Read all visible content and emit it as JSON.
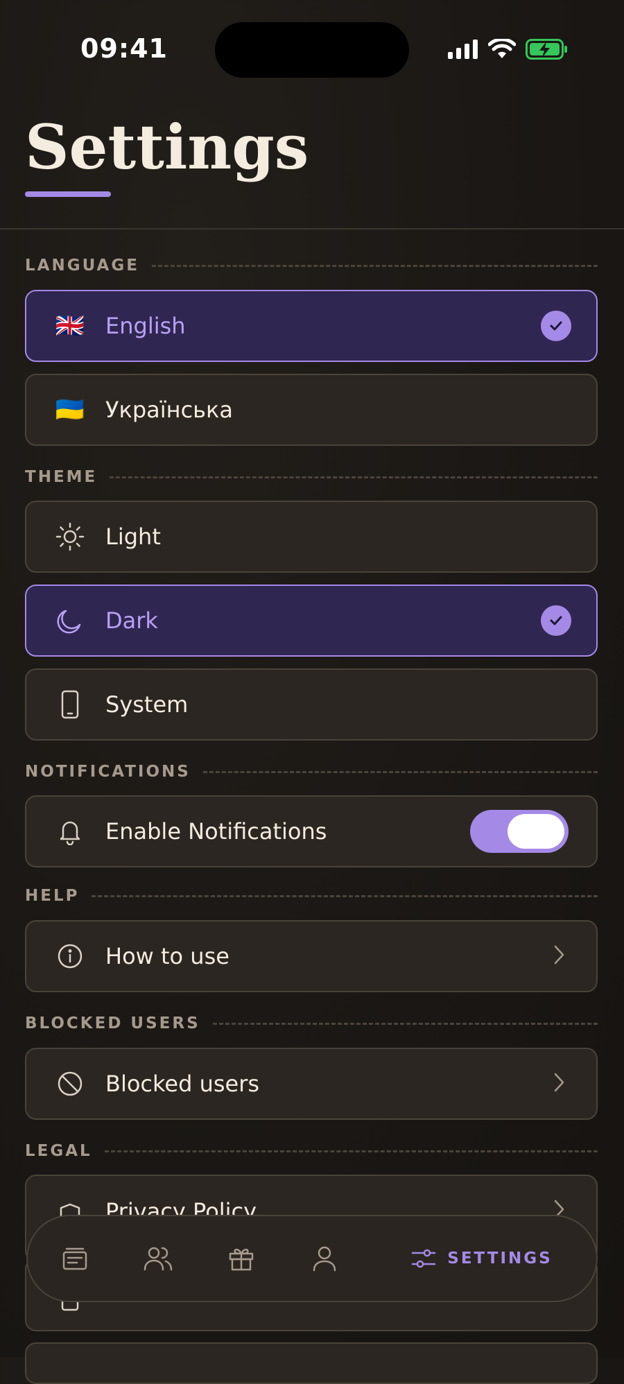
{
  "status_bar": {
    "time": "09:41"
  },
  "header": {
    "title": "Settings"
  },
  "sections": {
    "language": "LANGUAGE",
    "theme": "THEME",
    "notifications": "NOTIFICATIONS",
    "help": "HELP",
    "blocked": "BLOCKED USERS",
    "legal": "LEGAL"
  },
  "language_options": [
    {
      "label": "English",
      "flag": "🇬🇧",
      "selected": true
    },
    {
      "label": "Українська",
      "flag": "🇺🇦",
      "selected": false
    }
  ],
  "theme_options": [
    {
      "label": "Light",
      "icon": "sun-icon",
      "selected": false
    },
    {
      "label": "Dark",
      "icon": "moon-icon",
      "selected": true
    },
    {
      "label": "System",
      "icon": "phone-icon",
      "selected": false
    }
  ],
  "notifications": {
    "label": "Enable Notifications",
    "enabled": true
  },
  "help": {
    "how_to_use": "How to use"
  },
  "blocked": {
    "label": "Blocked users"
  },
  "legal": {
    "privacy": "Privacy Policy"
  },
  "tabbar": {
    "items": [
      "feed-icon",
      "friends-icon",
      "gift-icon",
      "profile-icon",
      "settings-icon"
    ],
    "active_label": "SETTINGS"
  },
  "colors": {
    "accent": "#a48ae6",
    "background": "#1b1815",
    "card": "#2b2621",
    "selected_card": "#302652"
  }
}
